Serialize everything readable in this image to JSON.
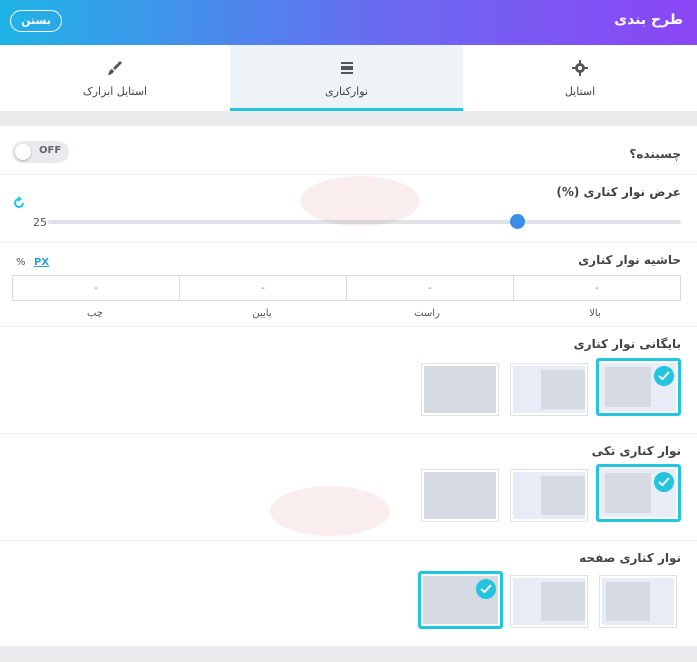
{
  "header": {
    "title": "طرح بندی",
    "close_label": "بستن"
  },
  "tabs": [
    {
      "label": "استایل",
      "icon": "gear-icon"
    },
    {
      "label": "نوارکناری",
      "icon": "sidebar-icon"
    },
    {
      "label": "استایل ابزارک",
      "icon": "brush-icon"
    }
  ],
  "sticky": {
    "label": "چسبنده؟",
    "state": "OFF"
  },
  "width": {
    "label": "عرض نوار کناری (%)",
    "value": "25",
    "fraction": 0.75
  },
  "padding": {
    "label": "حاشیه نوار کناری",
    "unit_px": "PX",
    "unit_pct": "%",
    "fields": [
      {
        "value": "-",
        "label": "بالا"
      },
      {
        "value": "-",
        "label": "راست"
      },
      {
        "value": "-",
        "label": "پایین"
      },
      {
        "value": "-",
        "label": "چپ"
      }
    ]
  },
  "sections": {
    "archive": {
      "label": "بایگانی نوار کناری"
    },
    "single": {
      "label": "نوار کناری تکی"
    },
    "page": {
      "label": "نوار کناری صفحه"
    }
  },
  "colors": {
    "accent": "#23c4dd",
    "thumb": "#3a8ee6"
  }
}
